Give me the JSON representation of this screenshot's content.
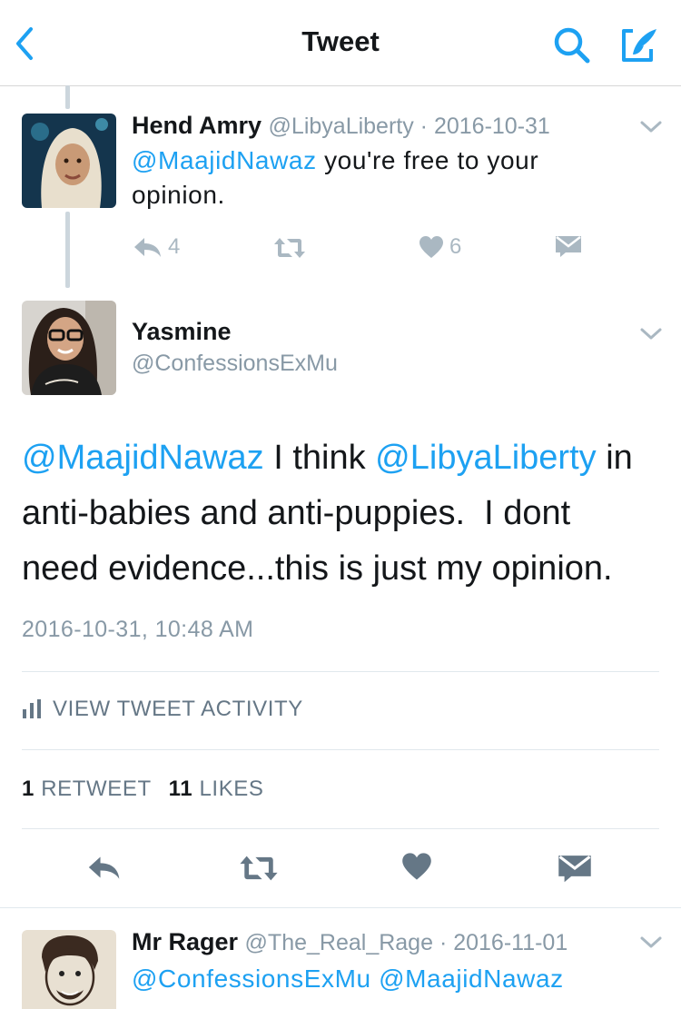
{
  "nav": {
    "title": "Tweet"
  },
  "reply1": {
    "name": "Hend Amry",
    "handle": "@LibyaLiberty",
    "date": "2016-10-31",
    "mention": "@MaajidNawaz",
    "text_a": " you're free to your",
    "text_b": "opinion.",
    "reply_count": "4",
    "like_count": "6"
  },
  "main": {
    "name": "Yasmine",
    "handle": "@ConfessionsExMu",
    "mention1": "@MaajidNawaz",
    "text1": " I think ",
    "mention2": "@LibyaLiberty",
    "text2": " in",
    "line2": "anti-babies and anti-puppies.  I dont",
    "line3": "need evidence...this is just my opinion.",
    "timestamp": "2016-10-31, 10:48 AM",
    "activity_label": "VIEW TWEET ACTIVITY",
    "retweet_count": "1",
    "retweet_label": "RETWEET",
    "like_count": "11",
    "like_label": "LIKES"
  },
  "reply2": {
    "name": "Mr Rager",
    "handle": "@The_Real_Rage",
    "date": "2016-11-01",
    "mention1": "@ConfessionsExMu",
    "mention2": "@MaajidNawaz"
  },
  "colors": {
    "accent": "#1da1f2",
    "muted": "#8899a6",
    "icon": "#657786"
  }
}
